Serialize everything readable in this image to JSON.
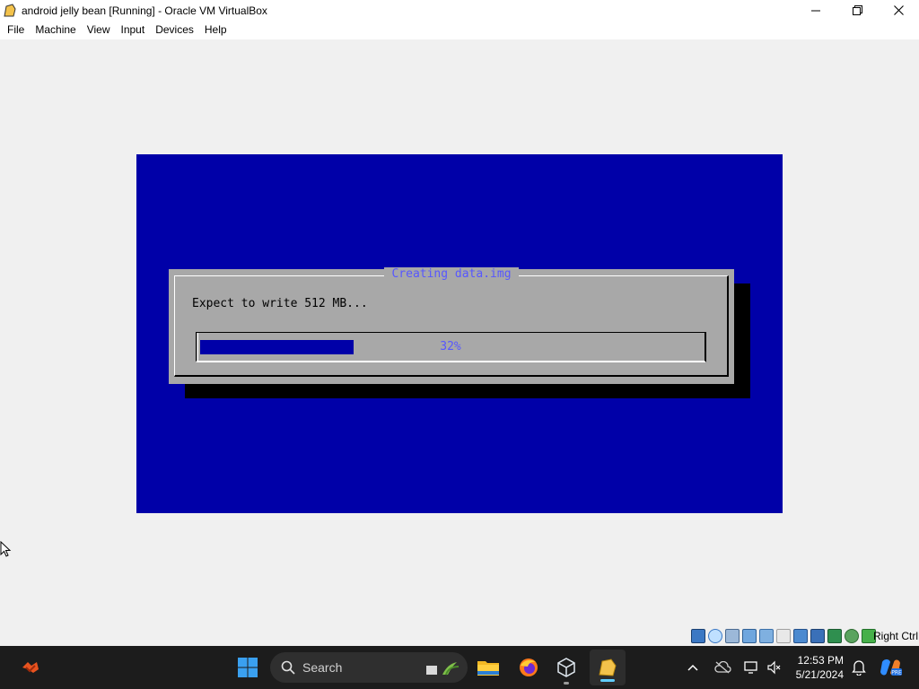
{
  "window": {
    "title": "android jelly bean [Running] - Oracle VM VirtualBox",
    "minimize_icon": "minimize-icon",
    "maximize_icon": "maximize-icon",
    "close_icon": "close-icon"
  },
  "menu": {
    "items": [
      "File",
      "Machine",
      "View",
      "Input",
      "Devices",
      "Help"
    ]
  },
  "vm": {
    "screen_color": "#0000a8",
    "dialog": {
      "title": "Creating data.img",
      "message": "Expect to write 512 MB...",
      "progress_text": "32%",
      "progress_value": 0.32
    }
  },
  "statusbar": {
    "host_key": "Right Ctrl",
    "icons": [
      "hard-disk-icon",
      "optical-drive-icon",
      "audio-icon",
      "network-icon",
      "usb-icon",
      "shared-folders-icon",
      "display-icon",
      "recording-icon",
      "cpu-icon",
      "mouse-integration-icon",
      "keyboard-icon"
    ]
  },
  "taskbar": {
    "search_placeholder": "Search",
    "time": "12:53 PM",
    "date": "5/21/2024"
  },
  "colors": {
    "dialog_bg": "#a8a8a8",
    "dialog_title": "#5757ff",
    "taskbar_bg": "#1c1c1c",
    "accent": "#60cdff"
  }
}
